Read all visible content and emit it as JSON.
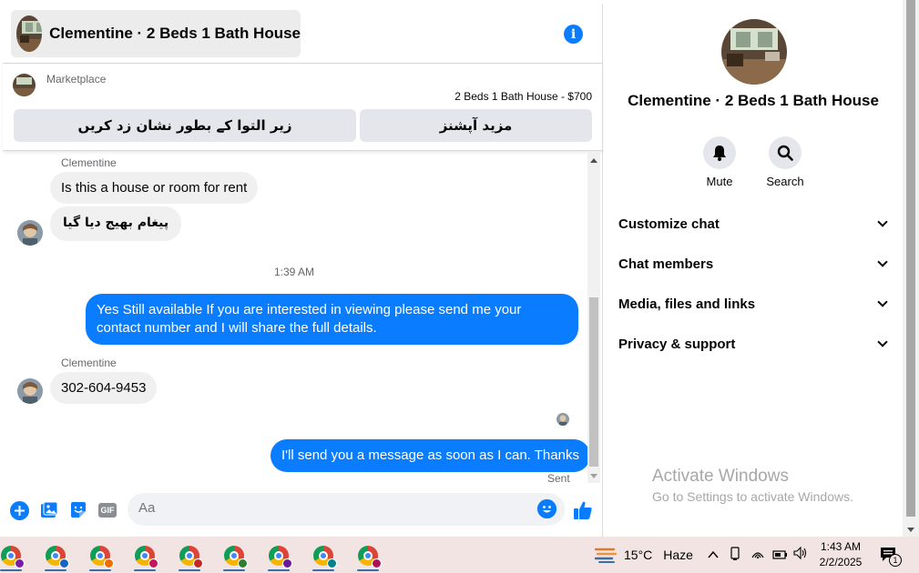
{
  "chat_header": {
    "title": "Clementine · 2 Beds 1 Bath House"
  },
  "marketplace": {
    "label": "Marketplace",
    "listing": "2 Beds 1 Bath House - $700",
    "button_mark": "زیر التوا کے بطور نشان زد کریں",
    "button_more": "مزید آپشنز"
  },
  "messages": [
    {
      "sender": "Clementine",
      "text": "Is this a house or room for rent"
    },
    {
      "text": "پیغام بھیج دیا گیا"
    },
    {
      "time": "1:39 AM"
    },
    {
      "text": "Yes Still available If you are interested in viewing please send me your contact number and I will share the full details."
    },
    {
      "sender": "Clementine",
      "text": "302-604-9453"
    },
    {
      "text": "I'll send you a message as soon as I can. Thanks",
      "status": "Sent"
    }
  ],
  "composer": {
    "placeholder": "Aa",
    "gif_label": "GIF"
  },
  "info_panel": {
    "name": "Clementine · 2 Beds 1 Bath House",
    "actions": [
      {
        "label": "Mute",
        "icon": "bell-icon"
      },
      {
        "label": "Search",
        "icon": "search-icon"
      }
    ],
    "sections": [
      "Customize chat",
      "Chat members",
      "Media, files and links",
      "Privacy & support"
    ]
  },
  "watermark": {
    "title": "Activate Windows",
    "subtitle": "Go to Settings to activate Windows."
  },
  "taskbar": {
    "apps": [
      {
        "icon": "chrome-icon",
        "profile_color": "#7b1fa2"
      },
      {
        "icon": "chrome-icon",
        "profile_color": "#1565c0"
      },
      {
        "icon": "chrome-icon",
        "profile_color": "#ef6c00"
      },
      {
        "icon": "chrome-icon",
        "profile_color": "#c2185b"
      },
      {
        "icon": "chrome-icon",
        "profile_color": "#c62828"
      },
      {
        "icon": "chrome-icon",
        "profile_color": "#2e7d32"
      },
      {
        "icon": "chrome-icon",
        "profile_color": "#6a1b9a"
      },
      {
        "icon": "chrome-icon",
        "profile_color": "#00838f"
      },
      {
        "icon": "chrome-icon",
        "profile_color": "#ad1457"
      }
    ],
    "weather_temp": "15°C",
    "weather_desc": "Haze",
    "time": "1:43 AM",
    "date": "2/2/2025",
    "notification_count": "1"
  },
  "colors": {
    "accent": "#0a7cff",
    "bubble_in": "#f0f0f0",
    "taskbar": "#f3e4e4"
  }
}
